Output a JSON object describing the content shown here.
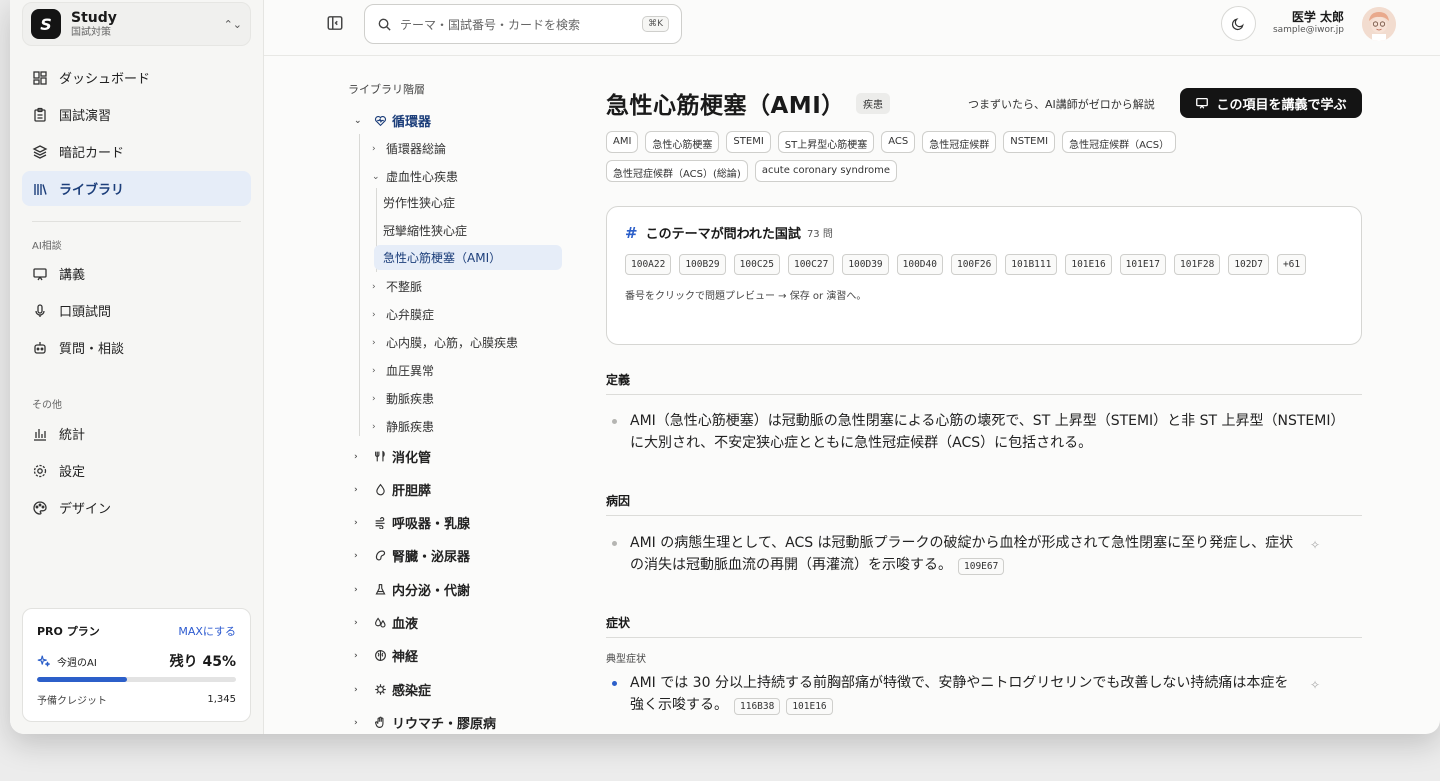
{
  "workspace": {
    "name": "Study",
    "sub": "国試対策"
  },
  "nav": {
    "main": [
      {
        "label": "ダッシュボード",
        "icon": "dashboard-icon"
      },
      {
        "label": "国試演習",
        "icon": "clipboard-icon"
      },
      {
        "label": "暗記カード",
        "icon": "layers-icon"
      },
      {
        "label": "ライブラリ",
        "icon": "library-icon"
      }
    ],
    "ai_section": "AI相談",
    "ai": [
      {
        "label": "講義",
        "icon": "presentation-icon"
      },
      {
        "label": "口頭試問",
        "icon": "mic-icon"
      },
      {
        "label": "質問・相談",
        "icon": "bot-icon"
      }
    ],
    "other_section": "その他",
    "other": [
      {
        "label": "統計",
        "icon": "chart-icon"
      },
      {
        "label": "設定",
        "icon": "gear-icon"
      },
      {
        "label": "デザイン",
        "icon": "palette-icon"
      }
    ]
  },
  "pro": {
    "title": "PRO プラン",
    "upgrade": "MAXにする",
    "ai_label": "今週のAI",
    "remaining": "残り 45%",
    "remaining_fraction": 0.45,
    "credit_label": "予備クレジット",
    "credit_value": "1,345"
  },
  "topbar": {
    "search_placeholder": "テーマ・国試番号・カードを検索",
    "shortcut": "⌘K",
    "user_name": "医学 太郎",
    "user_email": "sample@iwor.jp"
  },
  "tree": {
    "title": "ライブラリ階層",
    "cardio": "循環器",
    "cardio_children": [
      "循環器総論",
      "虚血性心疾患"
    ],
    "ischemic_children": [
      "労作性狭心症",
      "冠攣縮性狭心症",
      "急性心筋梗塞（AMI）"
    ],
    "cardio_more": [
      "不整脈",
      "心弁膜症",
      "心内膜，心筋，心膜疾患",
      "血圧異常",
      "動脈疾患",
      "静脈疾患"
    ],
    "categories": [
      "消化管",
      "肝胆膵",
      "呼吸器・乳腺",
      "腎臓・泌尿器",
      "内分泌・代謝",
      "血液",
      "神経",
      "感染症",
      "リウマチ・膠原病"
    ]
  },
  "page": {
    "title": "急性心筋梗塞（AMI）",
    "badge": "疾患",
    "learn_hint": "つまずいたら、AI講師がゼロから解説",
    "learn_button": "この項目を講義で学ぶ",
    "tags": [
      "AMI",
      "急性心筋梗塞",
      "STEMI",
      "ST上昇型心筋梗塞",
      "ACS",
      "急性冠症候群",
      "NSTEMI",
      "急性冠症候群（ACS）",
      "急性冠症候群（ACS）(総論)",
      "acute coronary syndrome"
    ],
    "exam_title": "このテーマが問われた国試",
    "exam_count": "73 問",
    "exam_codes": [
      "100A22",
      "100B29",
      "100C25",
      "100C27",
      "100D39",
      "100D40",
      "100F26",
      "101B111",
      "101E16",
      "101E17",
      "101F28",
      "102D7",
      "+61"
    ],
    "exam_note": "番号をクリックで問題プレビュー → 保存 or 演習へ。",
    "sec_definition": "定義",
    "definition": "AMI（急性心筋梗塞）は冠動脈の急性閉塞による心筋の壊死で、ST 上昇型（STEMI）と非 ST 上昇型（NSTEMI）に大別され、不安定狭心症とともに急性冠症候群（ACS）に包括される。",
    "sec_cause": "病因",
    "cause": "AMI の病態生理として、ACS は冠動脈プラークの破綻から血栓が形成されて急性閉塞に至り発症し、症状の消失は冠動脈血流の再開（再灌流）を示唆する。",
    "cause_ref": "109E67",
    "sec_symptom": "症状",
    "symptom_sub": "典型症状",
    "symptom": "AMI では 30 分以上持続する前胸部痛が特徴で、安静やニトログリセリンでも改善しない持続痛は本症を強く示唆する。",
    "symptom_refs": [
      "116B38",
      "101E16"
    ]
  }
}
